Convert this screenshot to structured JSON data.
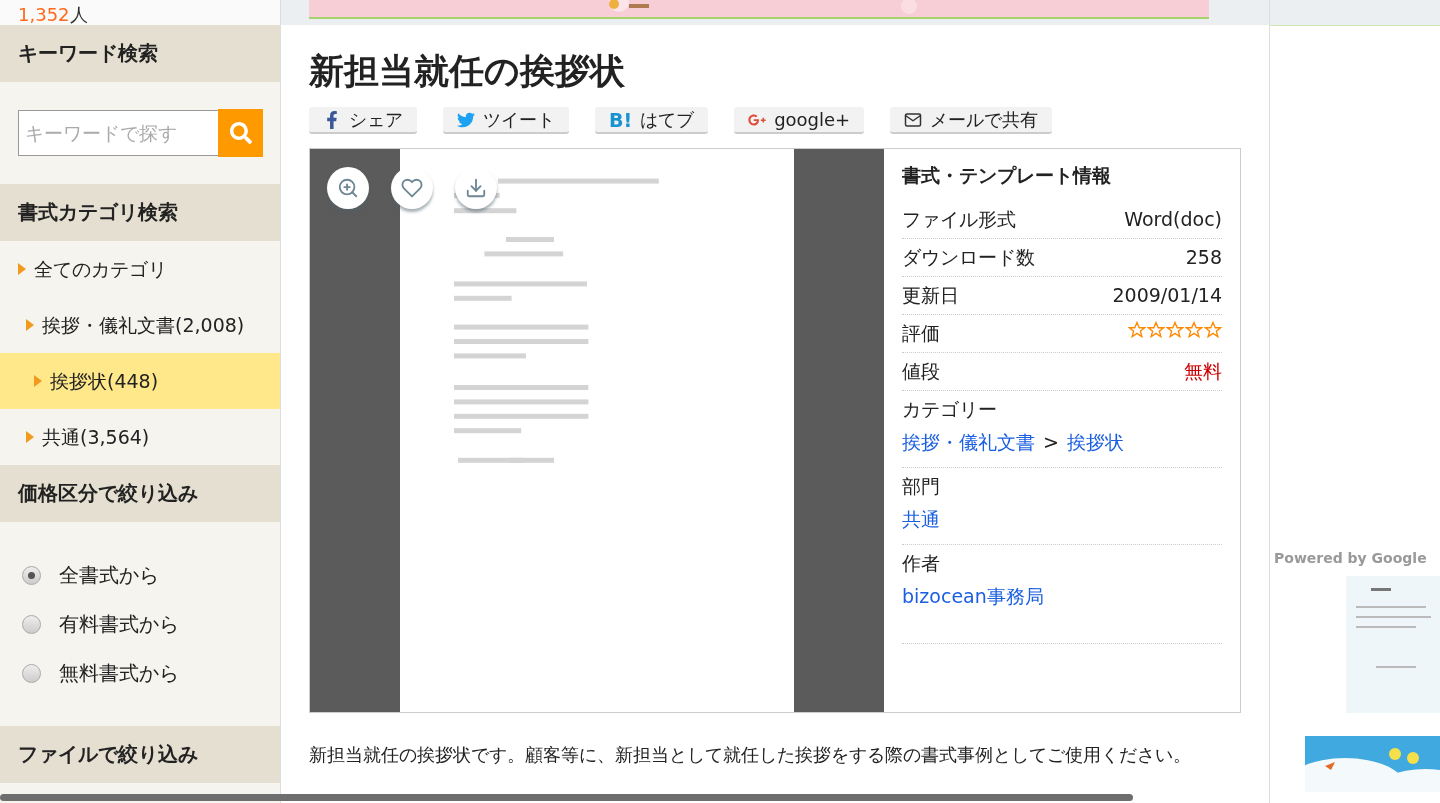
{
  "sidebar": {
    "member_count": {
      "number": "1,352",
      "unit": "人"
    },
    "keyword_search": {
      "heading": "キーワード検索",
      "placeholder": "キーワードで探す"
    },
    "category_search": {
      "heading": "書式カテゴリ検索",
      "items": [
        {
          "label": "全てのカテゴリ",
          "selected": false,
          "children": [
            {
              "label": "挨拶・儀礼文書(2,008)",
              "selected": false,
              "children": [
                {
                  "label": "挨拶状(448)",
                  "selected": true
                }
              ]
            },
            {
              "label": "共通(3,564)",
              "selected": false
            }
          ]
        }
      ]
    },
    "price_filter": {
      "heading": "価格区分で絞り込み",
      "options": [
        {
          "label": "全書式から",
          "selected": true
        },
        {
          "label": "有料書式から",
          "selected": false
        },
        {
          "label": "無料書式から",
          "selected": false
        }
      ]
    },
    "file_filter": {
      "heading": "ファイルで絞り込み"
    }
  },
  "main": {
    "title": "新担当就任の挨拶状",
    "share_buttons": [
      {
        "kind": "facebook",
        "label": "シェア"
      },
      {
        "kind": "twitter",
        "label": "ツイート"
      },
      {
        "kind": "hatena",
        "icon_text": "B!",
        "label": "はてブ"
      },
      {
        "kind": "googleplus",
        "label": "google+"
      },
      {
        "kind": "mail",
        "label": "メールで共有"
      }
    ],
    "info": {
      "title": "書式・テンプレート情報",
      "rows": [
        {
          "kind": "text",
          "label": "ファイル形式",
          "value": "Word(doc)"
        },
        {
          "kind": "text",
          "label": "ダウンロード数",
          "value": "258"
        },
        {
          "kind": "text",
          "label": "更新日",
          "value": "2009/01/14"
        },
        {
          "kind": "stars",
          "label": "評価",
          "stars": 0
        },
        {
          "kind": "price",
          "label": "値段",
          "value": "無料"
        },
        {
          "kind": "links",
          "label": "カテゴリー",
          "links": [
            "挨拶・儀礼文書",
            "挨拶状"
          ],
          "separator": ">"
        },
        {
          "kind": "links",
          "label": "部門",
          "links": [
            "共通"
          ]
        },
        {
          "kind": "links",
          "label": "作者",
          "links": [
            "bizocean事務局"
          ]
        }
      ]
    },
    "description": "新担当就任の挨拶状です。顧客等に、新担当として就任した挨拶をする際の書式事例としてご使用ください。"
  },
  "right_column": {
    "powered_by": "Powered by Google"
  }
}
